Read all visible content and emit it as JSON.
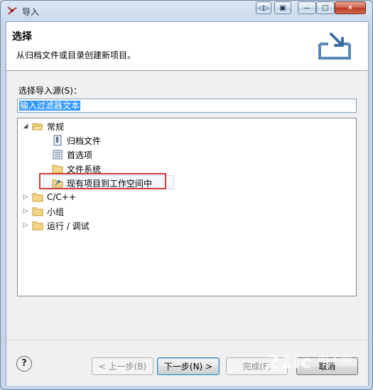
{
  "window": {
    "title": "导入"
  },
  "header": {
    "title": "选择",
    "description": "从归档文件或目录创建新项目。"
  },
  "source": {
    "label": "选择导入源(S)：",
    "filter_text": "输入过滤器文本"
  },
  "tree": {
    "general": {
      "label": "常规",
      "expanded": true,
      "children": [
        "归档文件",
        "首选项",
        "文件系统",
        "现有项目到工作空间中"
      ]
    },
    "cpp": {
      "label": "C/C++",
      "expanded": false
    },
    "team": {
      "label": "小组",
      "expanded": false
    },
    "rundebug": {
      "label": "运行 / 调试",
      "expanded": false
    }
  },
  "buttons": {
    "back": "< 上一步(B)",
    "next": "下一步(N) >",
    "finish": "完成(F)",
    "cancel": "取消",
    "help": "?"
  },
  "watermark": {
    "text": "21ic",
    "sub": "电子网"
  },
  "colors": {
    "highlight": "#3399ff",
    "annotation": "#d03a3a"
  }
}
